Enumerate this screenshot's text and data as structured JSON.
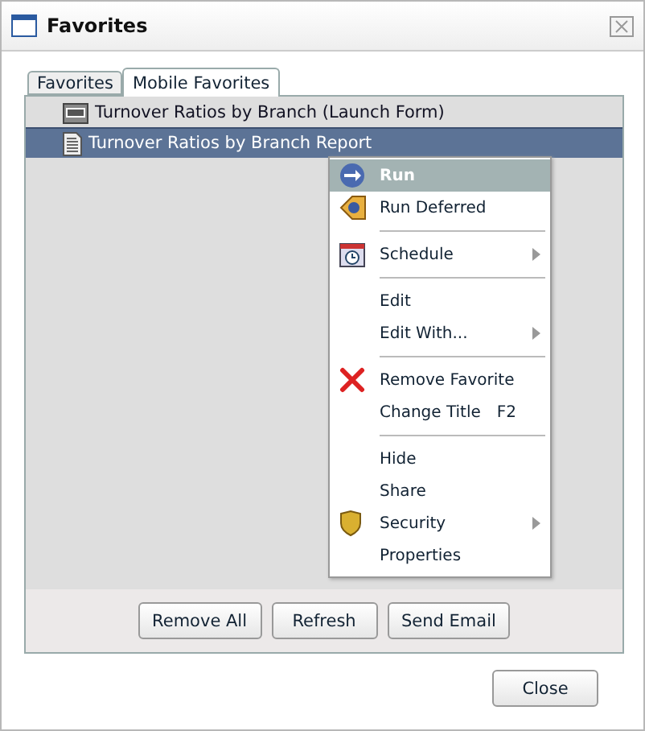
{
  "window": {
    "title": "Favorites"
  },
  "tabs": [
    {
      "label": "Favorites",
      "selected": false
    },
    {
      "label": "Mobile Favorites",
      "selected": true
    }
  ],
  "rows": [
    {
      "label": "Turnover Ratios by Branch (Launch Form)",
      "kind": "url",
      "selected": false
    },
    {
      "label": "Turnover Ratios by Branch Report",
      "kind": "document",
      "selected": true
    }
  ],
  "context_menu": [
    {
      "kind": "run",
      "label": "Run",
      "selected": true,
      "submenu": false
    },
    {
      "kind": "deferred",
      "label": "Run Deferred",
      "selected": false,
      "submenu": false
    },
    {
      "kind": "separator"
    },
    {
      "kind": "calendar",
      "label": "Schedule",
      "selected": false,
      "submenu": true
    },
    {
      "kind": "separator"
    },
    {
      "kind": "plain",
      "label": "Edit",
      "selected": false,
      "submenu": false
    },
    {
      "kind": "plain",
      "label": "Edit With...",
      "selected": false,
      "submenu": true
    },
    {
      "kind": "separator"
    },
    {
      "kind": "remove",
      "label": "Remove Favorite",
      "selected": false,
      "submenu": false
    },
    {
      "kind": "plain",
      "label": "Change Title",
      "shortcut": "F2",
      "selected": false,
      "submenu": false
    },
    {
      "kind": "separator"
    },
    {
      "kind": "plain",
      "label": "Hide",
      "selected": false,
      "submenu": false
    },
    {
      "kind": "plain",
      "label": "Share",
      "selected": false,
      "submenu": false
    },
    {
      "kind": "shield",
      "label": "Security",
      "selected": false,
      "submenu": true
    },
    {
      "kind": "plain",
      "label": "Properties",
      "selected": false,
      "submenu": false
    }
  ],
  "panel_buttons": [
    "Remove All",
    "Refresh",
    "Send Email"
  ],
  "footer_buttons": [
    "Close"
  ]
}
